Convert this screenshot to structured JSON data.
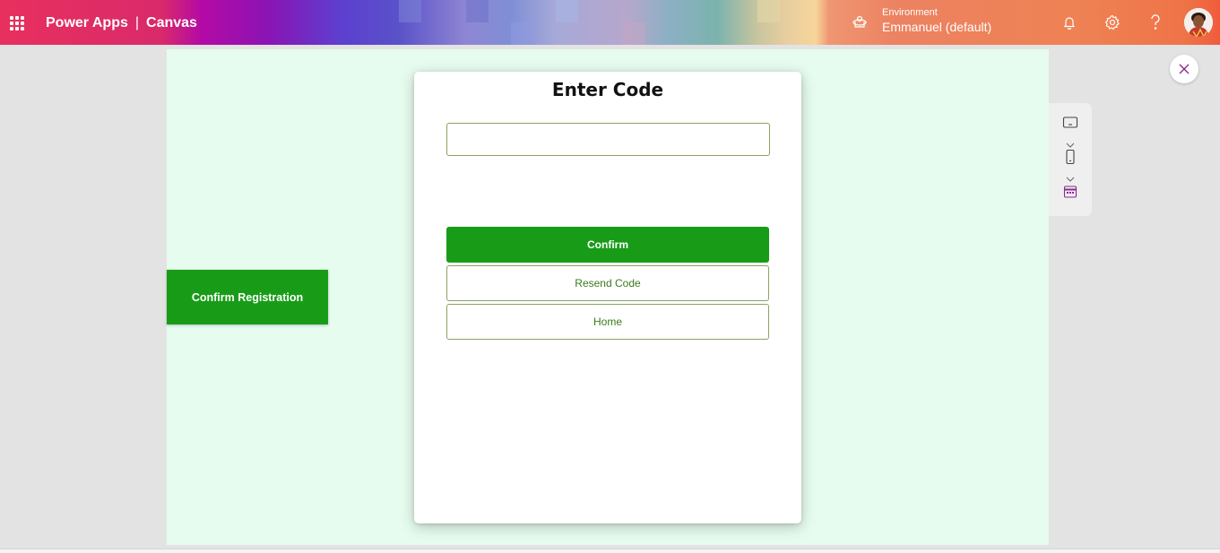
{
  "header": {
    "app_name": "Power Apps",
    "separator": "|",
    "mode": "Canvas",
    "environment_label": "Environment",
    "environment_value": "Emmanuel (default)",
    "icons": [
      "waffle-icon",
      "environment-icon",
      "bell-icon",
      "gear-icon",
      "help-icon",
      "avatar"
    ]
  },
  "canvas": {
    "background_color": "#e6fcee",
    "confirm_registration_label": "Confirm Registration"
  },
  "dialog": {
    "title": "Enter Code",
    "code_input_value": "",
    "confirm_label": "Confirm",
    "resend_label": "Resend Code",
    "home_label": "Home"
  },
  "colors": {
    "primary_green": "#189c18",
    "outline_green": "#8aa262",
    "outline_text": "#3b7a1c"
  },
  "side_panel": {
    "icons": [
      "tablet-icon",
      "chevron-down-icon",
      "phone-icon",
      "chevron-down-icon",
      "calendar-icon"
    ]
  }
}
